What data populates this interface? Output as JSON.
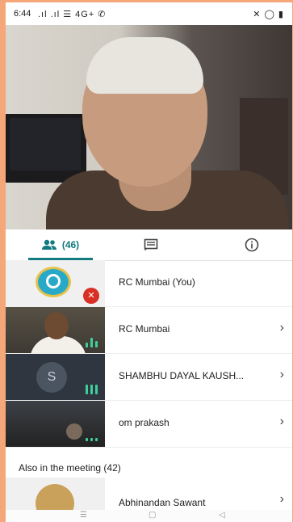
{
  "status_bar": {
    "time": "6:44",
    "signal": ".ıl .ıl ☰ 4G+ ✆",
    "right_icons": "✕ ◯ ▮"
  },
  "tabs": {
    "people_count": "(46)",
    "people_icon": "people-icon",
    "chat_icon": "chat-icon",
    "info_icon": "info-icon"
  },
  "participants": [
    {
      "name": "RC Mumbai (You)"
    },
    {
      "name": "RC Mumbai"
    },
    {
      "name": "SHAMBHU DAYAL KAUSH...",
      "initial": "S"
    },
    {
      "name": "om prakash"
    }
  ],
  "also_section": {
    "title": "Also in the meeting (42)",
    "first_name": "Abhinandan Sawant"
  },
  "navbar": {
    "menu": "☰",
    "home": "▢",
    "back": "◁"
  },
  "colors": {
    "accent": "#137a7f",
    "mute": "#d93025",
    "speaking": "#3ecf9c"
  }
}
